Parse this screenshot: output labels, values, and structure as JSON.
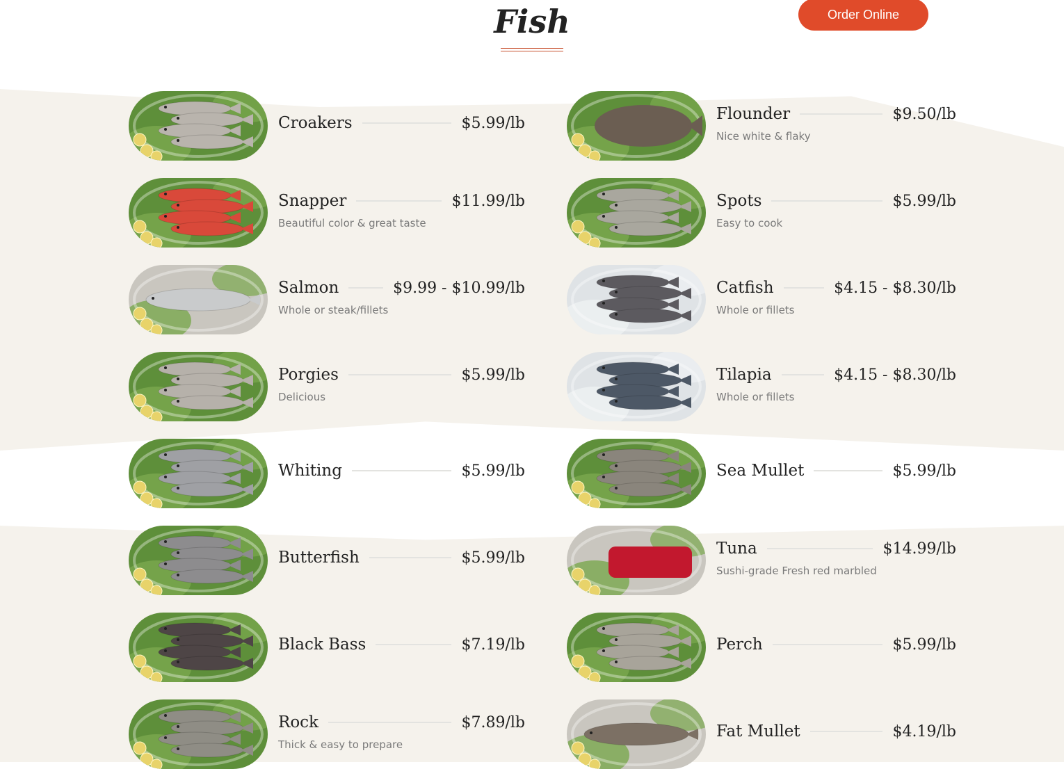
{
  "header": {
    "title": "Fish",
    "order_button": "Order Online"
  },
  "items": [
    {
      "name": "Croakers",
      "price": "$5.99/lb",
      "desc": "",
      "fish_color": "#b9b4ad",
      "plate": "greens"
    },
    {
      "name": "Flounder",
      "price": "$9.50/lb",
      "desc": "Nice white & flaky",
      "fish_color": "#6b5e52",
      "plate": "greens"
    },
    {
      "name": "Snapper",
      "price": "$11.99/lb",
      "desc": "Beautiful color & great taste",
      "fish_color": "#d9493a",
      "plate": "greens"
    },
    {
      "name": "Spots",
      "price": "$5.99/lb",
      "desc": "Easy to cook",
      "fish_color": "#a9a79e",
      "plate": "greens"
    },
    {
      "name": "Salmon",
      "price": "$9.99 - $10.99/lb",
      "desc": "Whole or steak/fillets",
      "fish_color": "#c9cbcc",
      "plate": "silver"
    },
    {
      "name": "Catfish",
      "price": "$4.15 - $8.30/lb",
      "desc": "Whole or fillets",
      "fish_color": "#5c5a5f",
      "plate": "ice"
    },
    {
      "name": "Porgies",
      "price": "$5.99/lb",
      "desc": "Delicious",
      "fish_color": "#b6b1aa",
      "plate": "greens"
    },
    {
      "name": "Tilapia",
      "price": "$4.15 - $8.30/lb",
      "desc": "Whole or fillets",
      "fish_color": "#4d5866",
      "plate": "ice"
    },
    {
      "name": "Whiting",
      "price": "$5.99/lb",
      "desc": "",
      "fish_color": "#9fa0a4",
      "plate": "greens"
    },
    {
      "name": "Sea Mullet",
      "price": "$5.99/lb",
      "desc": "",
      "fish_color": "#8a857c",
      "plate": "greens"
    },
    {
      "name": "Butterfish",
      "price": "$5.99/lb",
      "desc": "",
      "fish_color": "#8d8c8e",
      "plate": "greens"
    },
    {
      "name": "Tuna",
      "price": "$14.99/lb",
      "desc": "Sushi-grade Fresh red marbled",
      "fish_color": "#c2182e",
      "plate": "silver"
    },
    {
      "name": "Black Bass",
      "price": "$7.19/lb",
      "desc": "",
      "fish_color": "#4e4546",
      "plate": "greens"
    },
    {
      "name": "Perch",
      "price": "$5.99/lb",
      "desc": "",
      "fish_color": "#a8a49a",
      "plate": "greens"
    },
    {
      "name": "Rock",
      "price": "$7.89/lb",
      "desc": "Thick & easy to prepare",
      "fish_color": "#8f8d85",
      "plate": "greens"
    },
    {
      "name": "Fat Mullet",
      "price": "$4.19/lb",
      "desc": "",
      "fish_color": "#7c7064",
      "plate": "silver"
    }
  ],
  "colors": {
    "accent": "#e04b2a",
    "band": "#f5f2ec",
    "text": "#222222",
    "muted": "#7a7a7a",
    "lemon": "#e8d36a",
    "greens": "#4f8a32"
  }
}
